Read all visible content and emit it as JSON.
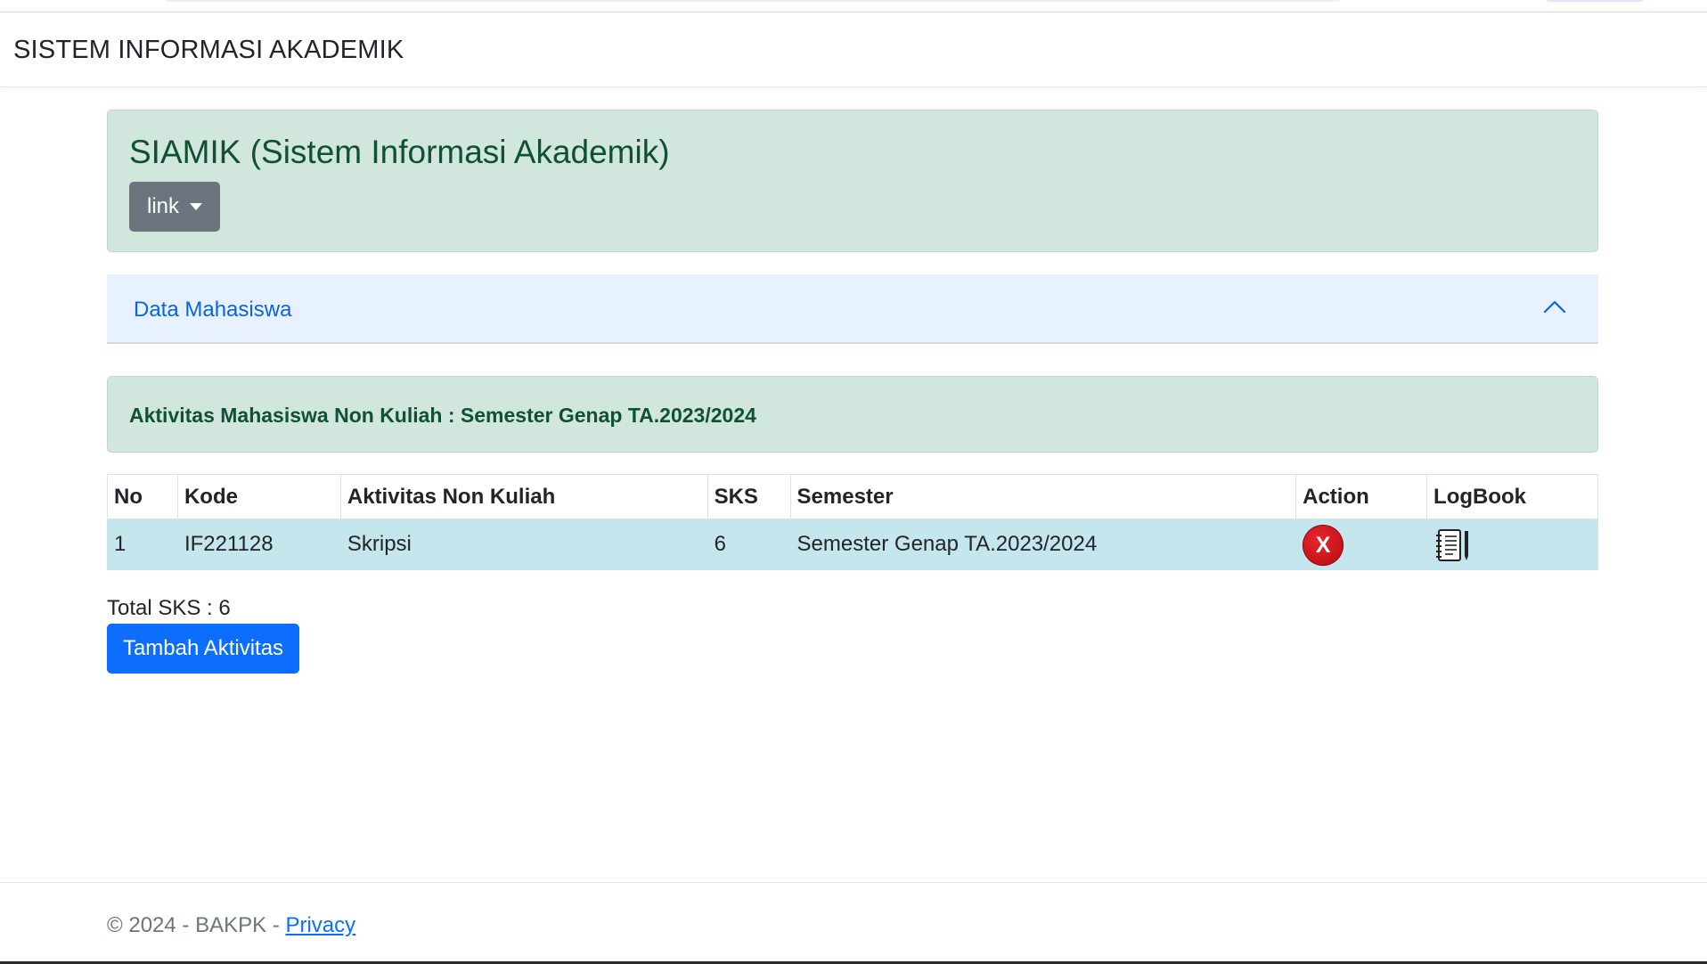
{
  "navbar": {
    "brand": "SISTEM INFORMASI AKADEMIK"
  },
  "hero": {
    "title": "SIAMIK (Sistem Informasi Akademik)",
    "dropdown_label": "link"
  },
  "accordion": {
    "label": "Data Mahasiswa",
    "expanded": true
  },
  "section": {
    "title": "Aktivitas Mahasiswa Non Kuliah : Semester Genap TA.2023/2024"
  },
  "table": {
    "headers": {
      "no": "No",
      "kode": "Kode",
      "aktivitas": "Aktivitas Non Kuliah",
      "sks": "SKS",
      "semester": "Semester",
      "action": "Action",
      "logbook": "LogBook"
    },
    "rows": [
      {
        "no": "1",
        "kode": "IF221128",
        "aktivitas": "Skripsi",
        "sks": "6",
        "semester": "Semester Genap TA.2023/2024",
        "action_icon": "delete-icon",
        "action_glyph": "X",
        "logbook_icon": "logbook-icon"
      }
    ]
  },
  "summary": {
    "total_sks": "Total SKS : 6"
  },
  "buttons": {
    "add_label": "Tambah Aktivitas"
  },
  "footer": {
    "copyright": "© 2024 - BAKPK - ",
    "privacy_label": "Privacy"
  },
  "colors": {
    "success_bg": "#d1e7dd",
    "success_text": "#0f5132",
    "accordion_bg": "#e7f1ff",
    "accordion_text": "#0c63e4",
    "row_bg": "#c6e6ee",
    "primary": "#0d6efd",
    "secondary": "#6c757d",
    "danger": "#c81016"
  }
}
